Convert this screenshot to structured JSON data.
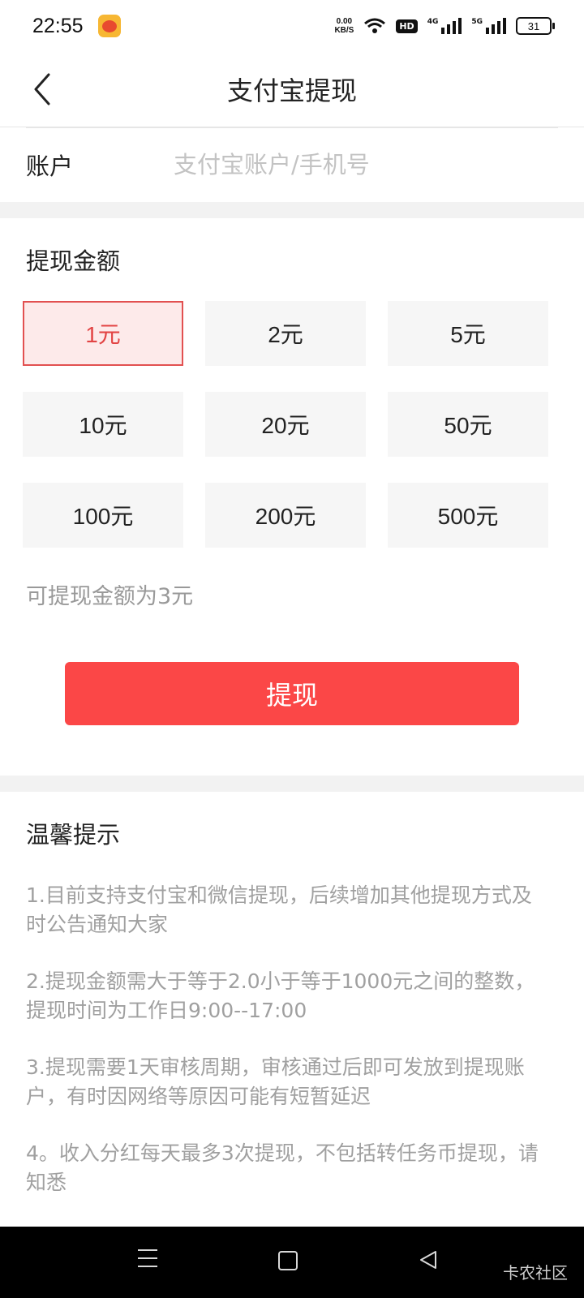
{
  "status_bar": {
    "time": "22:55",
    "net_speed_value": "0.00",
    "net_speed_unit": "KB/S",
    "hd_label": "HD",
    "signal1_label": "4G",
    "signal2_label": "5G",
    "battery": "31"
  },
  "header": {
    "title": "支付宝提现"
  },
  "account": {
    "label": "账户",
    "placeholder": "支付宝账户/手机号",
    "value": ""
  },
  "amount": {
    "title": "提现金额",
    "options": [
      "1元",
      "2元",
      "5元",
      "10元",
      "20元",
      "50元",
      "100元",
      "200元",
      "500元"
    ],
    "selected": "1元",
    "available_text": "可提现金额为3元"
  },
  "actions": {
    "withdraw_label": "提现"
  },
  "tips": {
    "title": "温馨提示",
    "items": [
      "1.目前支持支付宝和微信提现，后续增加其他提现方式及时公告通知大家",
      "2.提现金额需大于等于2.0小于等于1000元之间的整数，提现时间为工作日9:00--17:00",
      "3.提现需要1天审核周期，审核通过后即可发放到提现账户，有时因网络等原因可能有短暂延迟",
      "4。收入分红每天最多3次提现，不包括转任务币提现，请知悉"
    ]
  },
  "watermark": "卡农社区",
  "colors": {
    "accent": "#fb4747",
    "selected_bg": "#fdeaea",
    "selected_border": "#e25050"
  },
  "icons": {
    "back": "chevron-left-icon",
    "menu": "menu-icon",
    "home": "home-square-icon",
    "nav_back": "triangle-back-icon"
  }
}
